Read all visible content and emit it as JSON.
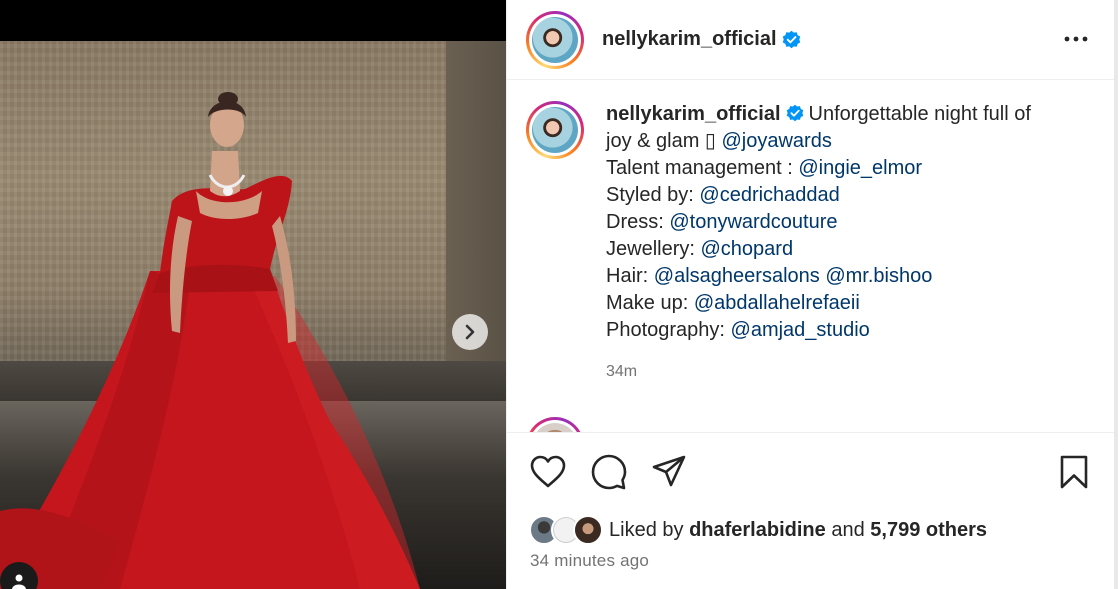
{
  "post": {
    "author": "nellykarim_official",
    "caption_lines": [
      {
        "text": "Unforgettable night full of"
      },
      {
        "text": "joy & glam ▯ ",
        "mention": "@joyawards"
      },
      {
        "text": "Talent management : ",
        "mention": "@ingie_elmor"
      },
      {
        "text": "Styled by: ",
        "mention": "@cedrichaddad"
      },
      {
        "text": "Dress: ",
        "mention": "@tonywardcouture"
      },
      {
        "text": "Jewellery: ",
        "mention": "@chopard"
      },
      {
        "text": "Hair: ",
        "mention": "@alsagheersalons",
        "mention2": "@mr.bishoo"
      },
      {
        "text": "Make up: ",
        "mention": "@abdallahelrefaeii"
      },
      {
        "text": "Photography: ",
        "mention": "@amjad_studio"
      }
    ],
    "caption_age": "34m",
    "liked_by_prefix": "Liked by",
    "liked_by_user": "dhaferlabidine",
    "liked_by_and": "and",
    "liked_by_others": "5,799 others",
    "posted_time": "34 minutes ago"
  },
  "icons": {
    "verified": "verified-badge-icon",
    "more": "more-options-icon",
    "like": "heart-icon",
    "comment": "comment-icon",
    "share": "send-icon",
    "save": "bookmark-icon",
    "next": "chevron-right-icon",
    "tag": "user-tag-icon"
  },
  "colors": {
    "verified_blue": "#0095f6",
    "mention": "#00376b",
    "dress_red": "#c4161c"
  }
}
